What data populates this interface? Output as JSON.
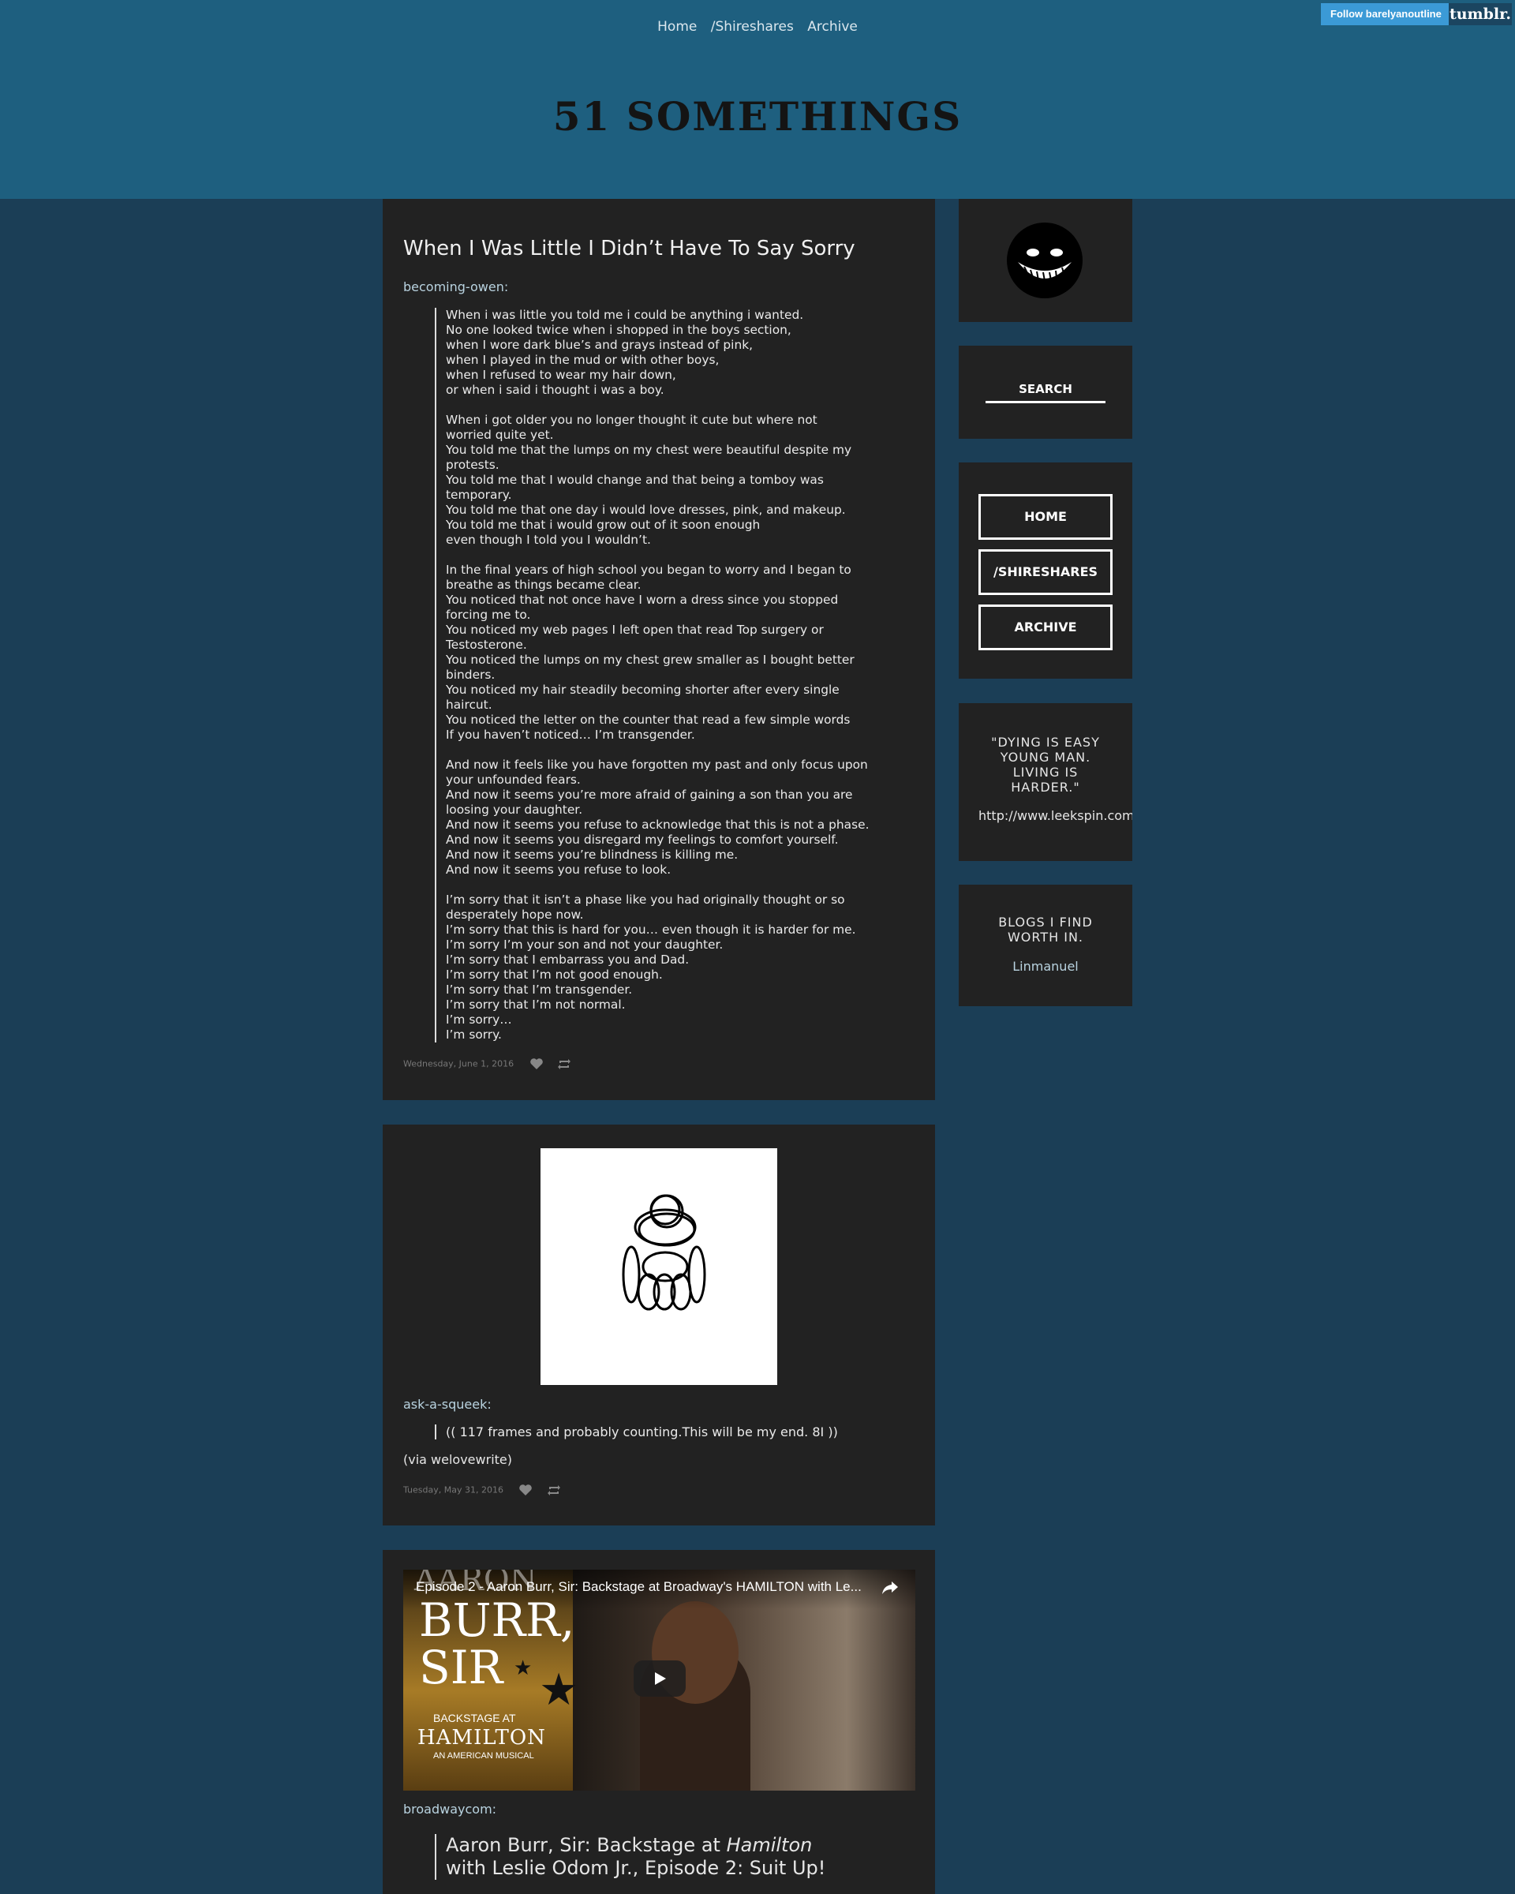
{
  "header": {
    "nav": [
      "Home",
      "/Shireshares",
      "Archive"
    ],
    "follow_label": "Follow barelyanoutline",
    "tumblr_label": "tumblr.",
    "site_title": "51 SOMETHINGS"
  },
  "post1": {
    "title": "When I Was Little I Didn’t Have To Say Sorry",
    "source": "becoming-owen:",
    "paragraphs": [
      "When i was little you told me i could be anything i wanted.\nNo one looked twice when i shopped in the boys section,\nwhen I wore dark blue’s and grays instead of pink,\nwhen I played in the mud or with other boys,\nwhen I refused to wear my hair down,\nor when i said i thought i was a boy.",
      "When i got older you no longer thought it cute but where not\nworried quite yet.\nYou told me that the lumps on my chest were beautiful despite my\nprotests.\nYou told me that I would change and that being a tomboy was\ntemporary.\nYou told me that one day i would love dresses, pink, and makeup.\nYou told me that i would grow out of it soon enough\neven though I told you I wouldn’t.",
      "In the final years of high school you began to worry and I began to\nbreathe as things became clear.\nYou noticed that not once have I worn a dress since you stopped\nforcing me to.\nYou noticed my web pages I left open that read Top surgery or\nTestosterone.\nYou noticed the lumps on my chest grew smaller as I bought better\nbinders.\nYou noticed my hair steadily becoming shorter after every single\nhaircut.\nYou noticed the letter on the counter that read a few simple words\nIf you haven’t noticed… I’m transgender.",
      "And now it feels like you have forgotten my past and only focus upon\nyour unfounded fears.\nAnd now it seems you’re more afraid of gaining a son than you are\nloosing your daughter.\nAnd now it seems you refuse to acknowledge that this is not a phase.\nAnd now it seems you disregard my feelings to comfort yourself.\nAnd now it seems you’re blindness is killing me.\nAnd now it seems you refuse to look.",
      "I’m sorry that it isn’t a phase like you had originally thought or so\ndesperately hope now.\nI’m sorry that this is hard for you… even though it is harder for me.\nI’m sorry I’m your son and not your daughter.\nI’m sorry that I embarrass you and Dad.\nI’m sorry that I’m not good enough.\nI’m sorry that I’m transgender.\nI’m sorry that I’m not normal.\nI’m sorry…\nI’m sorry."
    ],
    "date": "Wednesday, June 1, 2016"
  },
  "post2": {
    "source": "ask-a-squeek:",
    "quote": "(( 117 frames and probably counting.This will be my end. 8I  ))",
    "via": "(via welovewrite)",
    "date": "Tuesday, May 31, 2016"
  },
  "post3": {
    "video_title": "Episode 2 - Aaron Burr, Sir: Backstage at Broadway's HAMILTON with Le...",
    "poster_top": "AARON",
    "poster_burr": "BURR,",
    "poster_sir": "SIR",
    "poster_backstage": "BACKSTAGE AT",
    "poster_hamilton": "HAMILTON",
    "poster_musical": "AN AMERICAN MUSICAL",
    "source": "broadwaycom:",
    "quote_a": "Aaron Burr, Sir: Backstage at ",
    "quote_em": "Hamilton",
    "quote_b": "with Leslie Odom Jr., Episode 2: Suit Up!"
  },
  "sidebar": {
    "search_label": "SEARCH",
    "buttons": [
      "HOME",
      "/SHIRESHARES",
      "ARCHIVE"
    ],
    "quote": "\"DYING IS EASY YOUNG MAN. LIVING IS HARDER.\"",
    "link": "http://www.leekspin.com",
    "blogs_title": "BLOGS I FIND WORTH IN.",
    "blogs_item": "Linmanuel"
  },
  "colors": {
    "page_bg": "#1b3e56",
    "header_bg": "#1e5f7f",
    "card_bg": "#222222",
    "link": "#b9d3e0",
    "follow_button": "#3b9ad6"
  }
}
